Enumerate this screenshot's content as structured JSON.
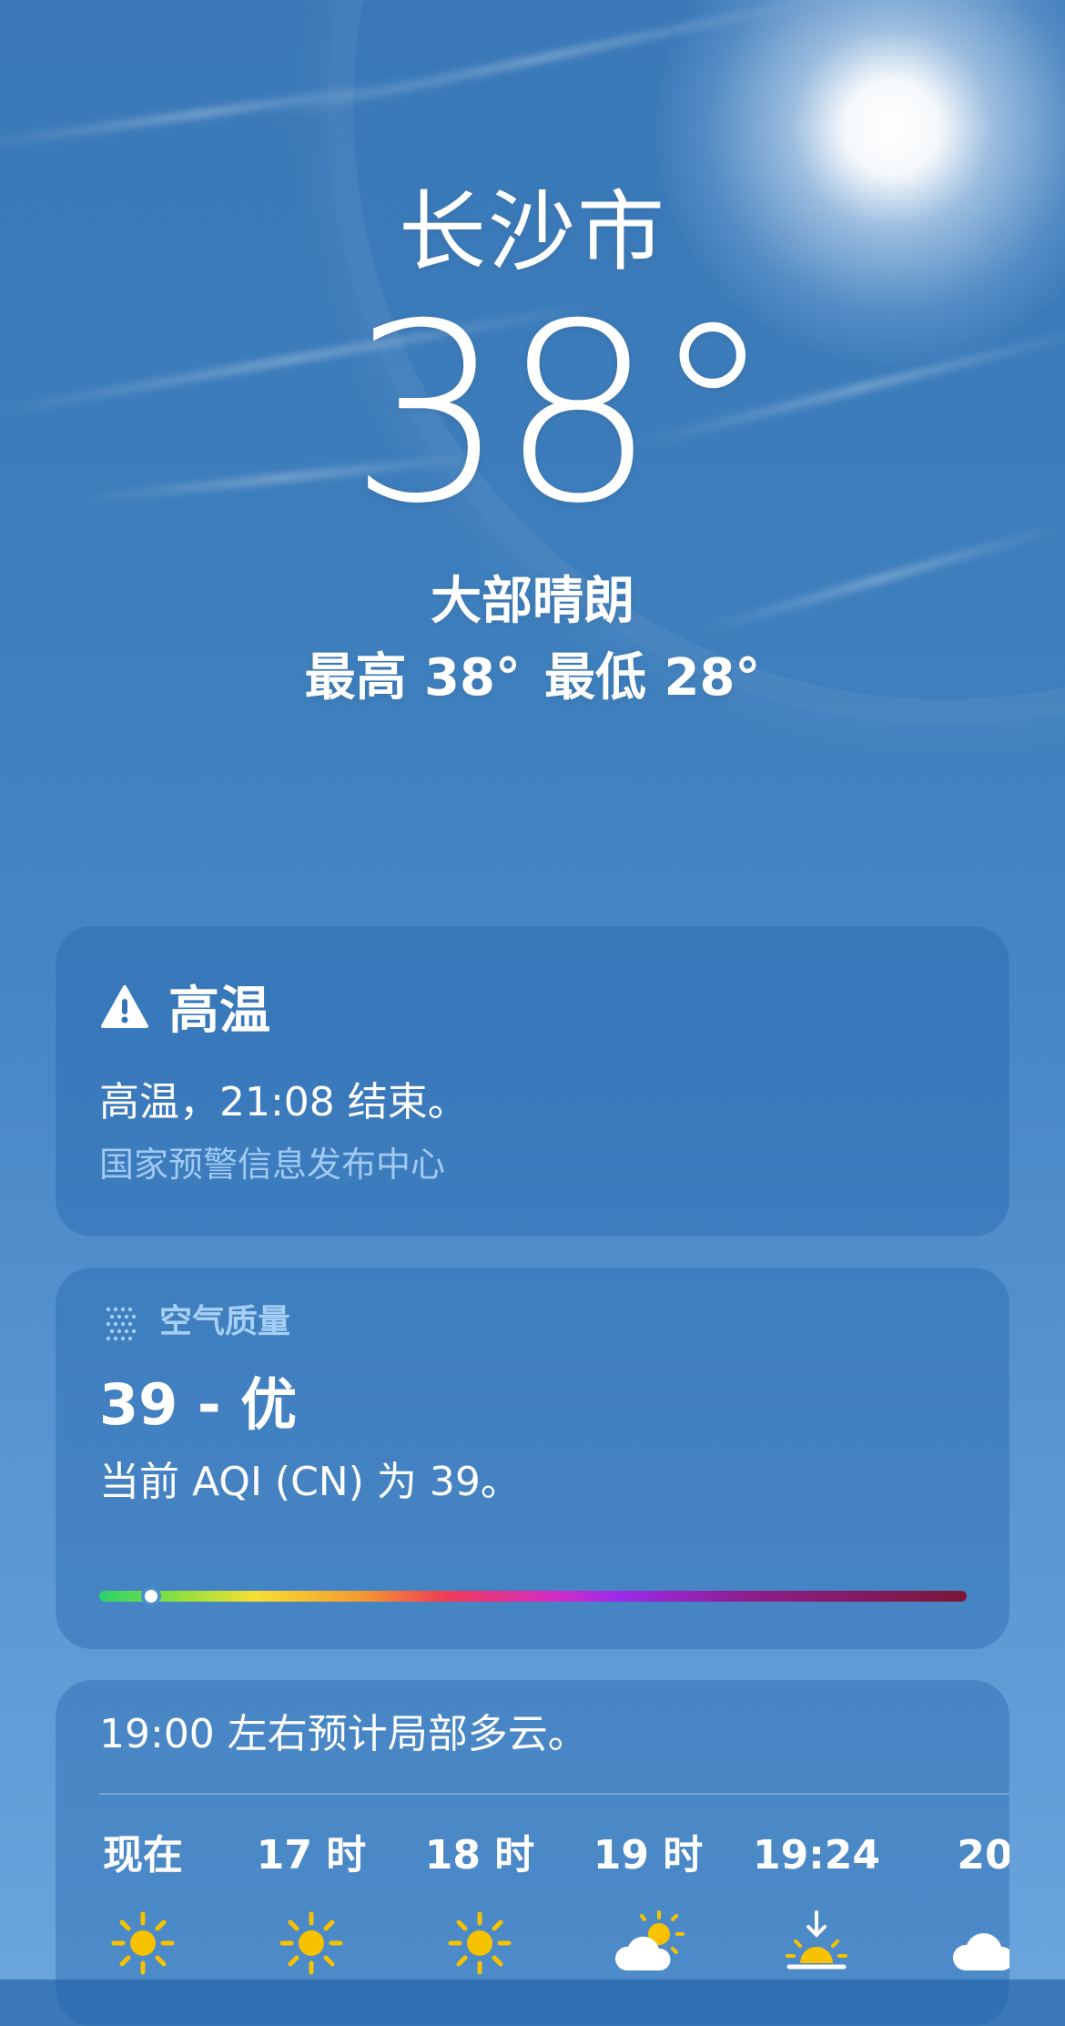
{
  "header": {
    "city": "长沙市",
    "temperature": "38°",
    "condition": "大部晴朗",
    "high": "最高 38°",
    "low": "最低 28°"
  },
  "alert": {
    "title": "高温",
    "text": "高温，21:08 结束。",
    "source": "国家预警信息发布中心"
  },
  "aqi": {
    "label": "空气质量",
    "value": "39 - 优",
    "description": "当前 AQI (CN) 为 39。",
    "level_fraction": 0.06
  },
  "hourly": {
    "summary": "19:00 左右预计局部多云。",
    "items": [
      {
        "time": "现在",
        "icon": "sun-icon"
      },
      {
        "time": "17 时",
        "icon": "sun-icon"
      },
      {
        "time": "18 时",
        "icon": "sun-icon"
      },
      {
        "time": "19 时",
        "icon": "partly-cloudy-icon"
      },
      {
        "time": "19:24",
        "icon": "sunset-icon"
      },
      {
        "time": "20",
        "icon": "cloud-icon"
      }
    ]
  },
  "colors": {
    "sun_icon": "#f7c300",
    "alert_source": "#9fcaf2",
    "aqi_label": "#a5cff4"
  }
}
